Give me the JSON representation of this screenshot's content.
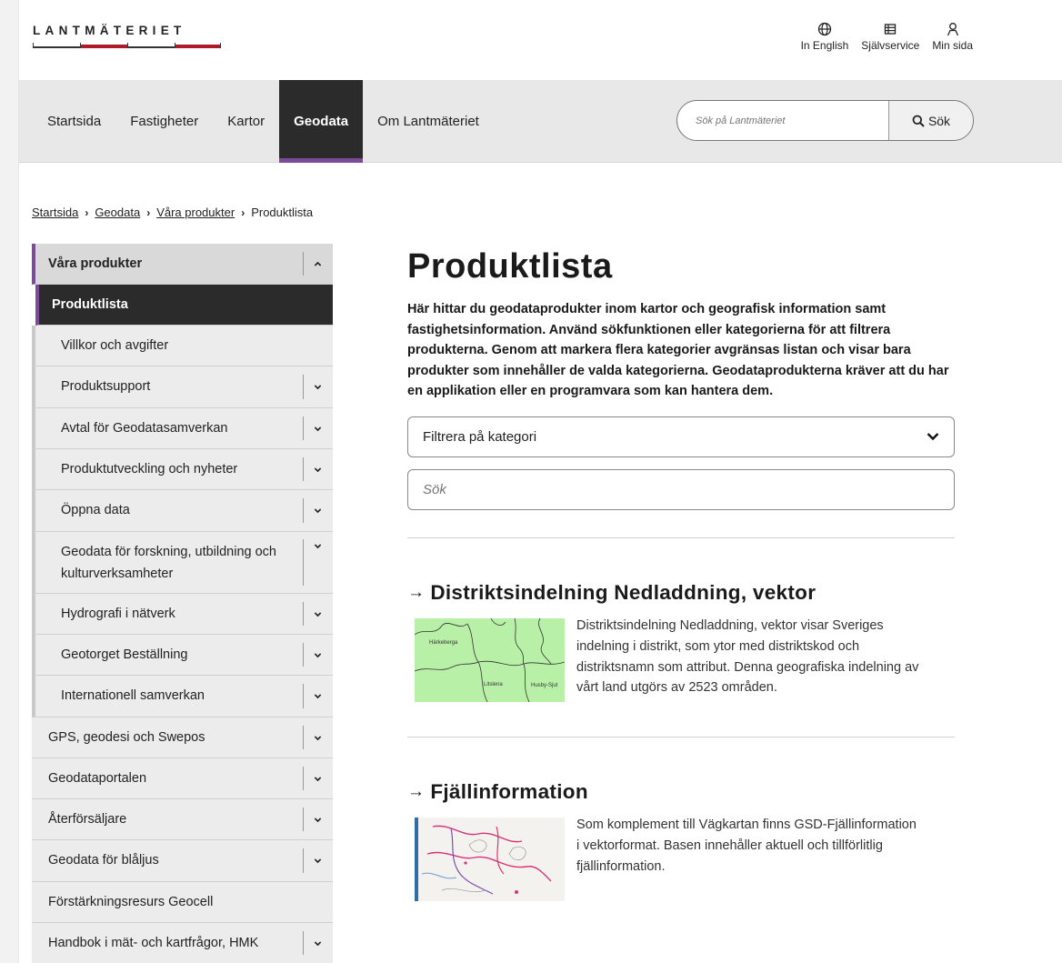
{
  "header": {
    "logo_text": "LANTMÄTERIET",
    "utility_links": [
      {
        "label": "In English",
        "icon": "globe-icon"
      },
      {
        "label": "Självservice",
        "icon": "list-icon"
      },
      {
        "label": "Min sida",
        "icon": "user-icon"
      }
    ]
  },
  "nav": {
    "items": [
      {
        "label": "Startsida"
      },
      {
        "label": "Fastigheter"
      },
      {
        "label": "Kartor"
      },
      {
        "label": "Geodata",
        "active": true
      },
      {
        "label": "Om Lantmäteriet"
      }
    ],
    "search_placeholder": "Sök på Lantmäteriet",
    "search_button": "Sök"
  },
  "breadcrumb": {
    "items": [
      "Startsida",
      "Geodata",
      "Våra produkter"
    ],
    "current": "Produktlista"
  },
  "sidebar": {
    "items": [
      {
        "label": "Våra produkter",
        "expanded": true
      },
      {
        "label": "Produktlista",
        "active": true
      },
      {
        "label": "Villkor och avgifter"
      },
      {
        "label": "Produktsupport"
      },
      {
        "label": "Avtal för Geodatasamverkan"
      },
      {
        "label": "Produktutveckling och nyheter"
      },
      {
        "label": "Öppna data"
      },
      {
        "label": "Geodata för forskning, utbildning och kulturverksamheter"
      },
      {
        "label": "Hydrografi i nätverk"
      },
      {
        "label": "Geotorget Beställning"
      },
      {
        "label": "Internationell samverkan"
      },
      {
        "label": "GPS, geodesi och Swepos"
      },
      {
        "label": "Geodataportalen"
      },
      {
        "label": "Återförsäljare"
      },
      {
        "label": "Geodata för blåljus"
      },
      {
        "label": "Förstärkningsresurs Geocell"
      },
      {
        "label": "Handbok i mät- och kartfrågor, HMK"
      }
    ]
  },
  "main": {
    "title": "Produktlista",
    "intro": "Här hittar du geodataprodukter inom kartor och geografisk information samt fastighetsinformation. Använd sökfunktionen eller kategorierna för att filtrera produkterna. Genom att markera flera kategorier avgränsas listan och visar bara produkter som innehåller de valda kategorierna. Geodataprodukterna kräver att du har en applikation eller en programvara som kan hantera dem.",
    "filter_label": "Filtrera på kategori",
    "search_placeholder": "Sök",
    "products": [
      {
        "title": "Distriktsindelning Nedladdning, vektor",
        "description": "Distriktsindelning Nedladdning, vektor visar Sveriges indelning i distrikt, som ytor med distriktskod och distriktsnamn som attribut. Denna geografiska indelning av vårt land utgörs av 2523 områden.",
        "map_labels": [
          "Härkeberga",
          "Litslena",
          "Husby-Sjut"
        ]
      },
      {
        "title": "Fjällinformation",
        "description": "Som komplement till Vägkartan finns GSD-Fjällinformation i vektorformat. Basen innehåller aktuell och tillförlitlig fjällinformation."
      }
    ]
  }
}
